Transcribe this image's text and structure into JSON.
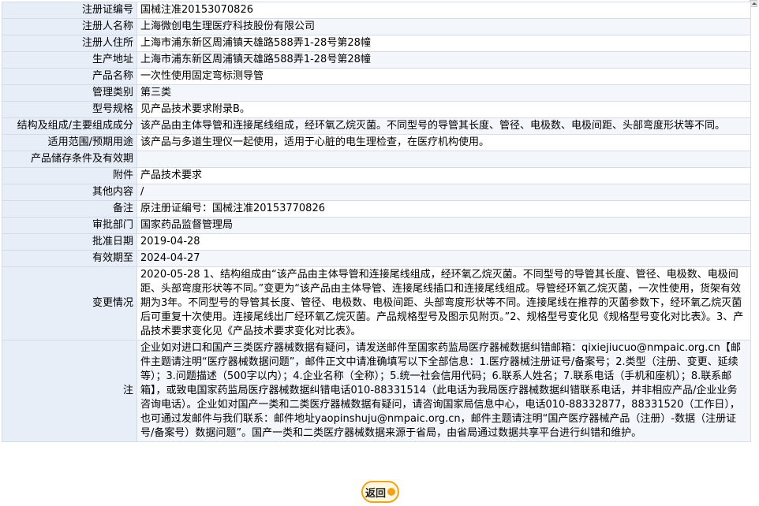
{
  "rows": [
    {
      "label": "注册证编号",
      "value": "国械注准20153070826"
    },
    {
      "label": "注册人名称",
      "value": "上海微创电生理医疗科技股份有限公司"
    },
    {
      "label": "注册人住所",
      "value": "上海市浦东新区周浦镇天雄路588弄1-28号第28幢"
    },
    {
      "label": "生产地址",
      "value": "上海市浦东新区周浦镇天雄路588弄1-28号第28幢"
    },
    {
      "label": "产品名称",
      "value": "一次性使用固定弯标测导管"
    },
    {
      "label": "管理类别",
      "value": "第三类"
    },
    {
      "label": "型号规格",
      "value": "见产品技术要求附录B。"
    },
    {
      "label": "结构及组成/主要组成成分",
      "value": "该产品由主体导管和连接尾线组成，经环氧乙烷灭菌。不同型号的导管其长度、管径、电极数、电极间距、头部弯度形状等不同。"
    },
    {
      "label": "适用范围/预期用途",
      "value": "该产品与多道生理仪一起使用，适用于心脏的电生理检查，在医疗机构使用。"
    },
    {
      "label": "产品储存条件及有效期",
      "value": ""
    },
    {
      "label": "附件",
      "value": "产品技术要求"
    },
    {
      "label": "其他内容",
      "value": "/"
    },
    {
      "label": "备注",
      "value": "原注册证编号：国械注准20153770826"
    },
    {
      "label": "审批部门",
      "value": "国家药品监督管理局"
    },
    {
      "label": "批准日期",
      "value": "2019-04-28"
    },
    {
      "label": "有效期至",
      "value": "2024-04-27"
    },
    {
      "label": "变更情况",
      "value": "2020-05-28 1、结构组成由“该产品由主体导管和连接尾线组成，经环氧乙烷灭菌。不同型号的导管其长度、管径、电极数、电极间距、头部弯度形状等不同。”变更为“该产品由主体导管、连接尾线插口和连接尾线组成。导管经环氧乙烷灭菌，一次性使用，货架有效期为3年。不同型号的导管其长度、管径、电极数、电极间距、头部弯度形状等不同。连接尾线在推荐的灭菌参数下，经环氧乙烷灭菌后可重复十次使用。连接尾线出厂经环氧乙烷灭菌。产品规格型号及图示见附页。”2、规格型号变化见《规格型号变化对比表》。3、产品技术要求变化见《产品技术要求变化对比表》。"
    },
    {
      "label": "注",
      "value": "企业如对进口和国产三类医疗器械数据有疑问，请发送邮件至国家药监局医疗器械数据纠错邮箱：qixiejiucuo@nmpaic.org.cn【邮件主题请注明“医疗器械数据问题”，邮件正文中请准确填写以下全部信息：1.医疗器械注册证号/备案号；2.类型（注册、变更、延续等）；3.问题描述（500字以内）；4.企业名称（全称）；5.统一社会信用代码；6.联系人姓名；7.联系电话（手机和座机）；8.联系邮箱】，或致电国家药监局医疗器械数据纠错电话010-88331514（此电话为我局医疗器械数据纠错联系电话，并非相应产品/企业业务咨询电话）。企业如对国产一类和二类医疗器械数据有疑问，请咨询国家局信息中心，电话010-88332877，88331520（工作日），也可通过发邮件与我们联系：邮件地址yaopinshuju@nmpaic.org.cn，邮件主题请注明“国产医疗器械产品（注册）-数据（注册证号/备案号）数据问题”。国产一类和二类医疗器械数据来源于省局，由省局通过数据共享平台进行纠错和维护。"
    }
  ],
  "back_button": {
    "label": "返回"
  }
}
